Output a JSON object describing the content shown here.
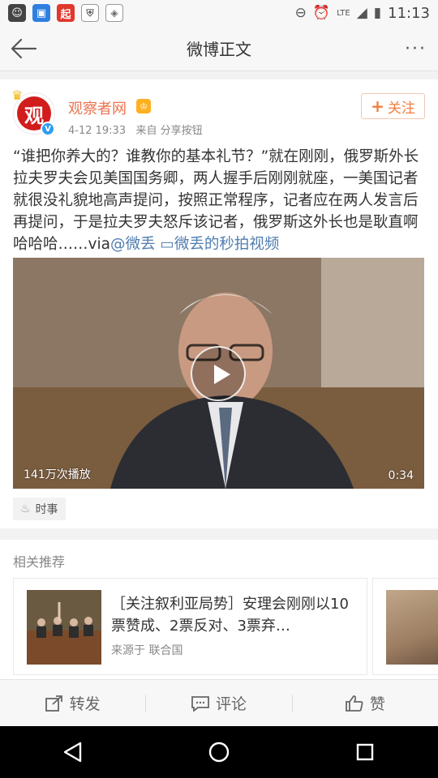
{
  "status_bar": {
    "time": "11:13",
    "network_label": "LTE",
    "app_icons": [
      "face-app-icon",
      "photo-app-icon",
      "qi-app-icon",
      "shield-app-icon",
      "security-app-icon"
    ],
    "qi_label": "起"
  },
  "nav": {
    "title": "微博正文",
    "more": "···"
  },
  "post": {
    "author": "观察者网",
    "avatar_text": "观",
    "time": "4-12 19:33",
    "source": "来自 分享按钮",
    "follow_label": "关注",
    "text_main": "“谁把你养大的？谁教你的基本礼节？”就在刚刚，俄罗斯外长拉夫罗夫会见美国国务卿，两人握手后刚刚就座，一美国记者就很没礼貌地高声提问，按照正常程序，记者应在两人发言后再提问，于是拉夫罗夫怒斥该记者，俄罗斯这外长也是耿直啊哈哈哈……via",
    "mention": "@微丢",
    "video_link": "微丢的秒拍视频",
    "video": {
      "play_count": "141万次播放",
      "duration": "0:34"
    },
    "tag": "时事"
  },
  "related": {
    "title": "相关推荐",
    "card": {
      "title": "［关注叙利亚局势］安理会刚刚以10票赞成、2票反对、3票弃…",
      "source": "来源于 联合国"
    }
  },
  "actions": {
    "repost": "转发",
    "comment": "评论",
    "like": "赞"
  },
  "colors": {
    "accent": "#f27d3f",
    "link": "#507daf",
    "username": "#eb7350"
  }
}
